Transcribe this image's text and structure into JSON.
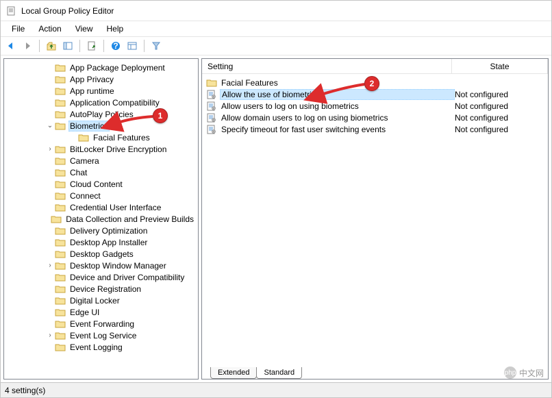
{
  "window": {
    "title": "Local Group Policy Editor"
  },
  "menu": {
    "file": "File",
    "action": "Action",
    "view": "View",
    "help": "Help"
  },
  "tree": {
    "items": [
      {
        "label": "App Package Deployment",
        "indent": 0,
        "expand": ""
      },
      {
        "label": "App Privacy",
        "indent": 0,
        "expand": ""
      },
      {
        "label": "App runtime",
        "indent": 0,
        "expand": ""
      },
      {
        "label": "Application Compatibility",
        "indent": 0,
        "expand": ""
      },
      {
        "label": "AutoPlay Policies",
        "indent": 0,
        "expand": ""
      },
      {
        "label": "Biometrics",
        "indent": 0,
        "expand": "⌄",
        "selected": true
      },
      {
        "label": "Facial Features",
        "indent": 2,
        "expand": ""
      },
      {
        "label": "BitLocker Drive Encryption",
        "indent": 0,
        "expand": ">"
      },
      {
        "label": "Camera",
        "indent": 0,
        "expand": ""
      },
      {
        "label": "Chat",
        "indent": 0,
        "expand": ""
      },
      {
        "label": "Cloud Content",
        "indent": 0,
        "expand": ""
      },
      {
        "label": "Connect",
        "indent": 0,
        "expand": ""
      },
      {
        "label": "Credential User Interface",
        "indent": 0,
        "expand": ""
      },
      {
        "label": "Data Collection and Preview Builds",
        "indent": 0,
        "expand": ""
      },
      {
        "label": "Delivery Optimization",
        "indent": 0,
        "expand": ""
      },
      {
        "label": "Desktop App Installer",
        "indent": 0,
        "expand": ""
      },
      {
        "label": "Desktop Gadgets",
        "indent": 0,
        "expand": ""
      },
      {
        "label": "Desktop Window Manager",
        "indent": 0,
        "expand": ">"
      },
      {
        "label": "Device and Driver Compatibility",
        "indent": 0,
        "expand": ""
      },
      {
        "label": "Device Registration",
        "indent": 0,
        "expand": ""
      },
      {
        "label": "Digital Locker",
        "indent": 0,
        "expand": ""
      },
      {
        "label": "Edge UI",
        "indent": 0,
        "expand": ""
      },
      {
        "label": "Event Forwarding",
        "indent": 0,
        "expand": ""
      },
      {
        "label": "Event Log Service",
        "indent": 0,
        "expand": ">"
      },
      {
        "label": "Event Logging",
        "indent": 0,
        "expand": ""
      }
    ]
  },
  "list": {
    "header_setting": "Setting",
    "header_state": "State",
    "items": [
      {
        "label": "Facial Features",
        "type": "folder",
        "state": ""
      },
      {
        "label": "Allow the use of biometrics",
        "type": "policy",
        "state": "Not configured",
        "selected": true
      },
      {
        "label": "Allow users to log on using biometrics",
        "type": "policy",
        "state": "Not configured"
      },
      {
        "label": "Allow domain users to log on using biometrics",
        "type": "policy",
        "state": "Not configured"
      },
      {
        "label": "Specify timeout for fast user switching events",
        "type": "policy",
        "state": "Not configured"
      }
    ]
  },
  "tabs": {
    "extended": "Extended",
    "standard": "Standard"
  },
  "status": {
    "text": "4 setting(s)"
  },
  "annotations": {
    "one": "1",
    "two": "2"
  },
  "watermark": {
    "text": "中文网",
    "prefix": "php"
  }
}
